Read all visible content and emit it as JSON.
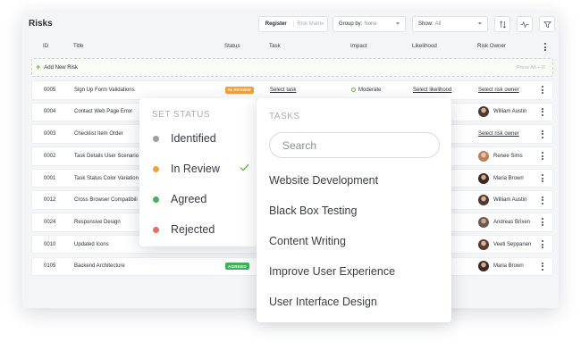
{
  "page": {
    "title": "Risks"
  },
  "toolbar": {
    "view_register": "Register",
    "view_matrix": "Risk Matrix",
    "group_label": "Group by:",
    "group_value": "None",
    "show_label": "Show:",
    "show_value": "All"
  },
  "columns": [
    "ID",
    "Title",
    "Status",
    "Task",
    "Impact",
    "Likelihood",
    "Risk Owner"
  ],
  "add_row": {
    "label": "Add New Risk",
    "hint": "Press Alt + R"
  },
  "rows": [
    {
      "id": "0005",
      "title": "Sign Up Form Validations",
      "status": "IN REVIEW",
      "status_color": "#f0a23e",
      "task": "Select task",
      "impact": "Moderate",
      "likelihood": "Select likelihood",
      "owner": "Select risk owner"
    },
    {
      "id": "0004",
      "title": "Contact Web Page Error",
      "owner": "William Austin"
    },
    {
      "id": "0003",
      "title": "Checklist Item Order",
      "owner": "Select risk owner"
    },
    {
      "id": "0002",
      "title": "Task Details User Scenario",
      "owner": "Renee Sims"
    },
    {
      "id": "0001",
      "title": "Task Status Color Variation",
      "owner": "Maria Brown"
    },
    {
      "id": "0012",
      "title": "Cross Browser Compatibili",
      "owner": "William Austin"
    },
    {
      "id": "0024",
      "title": "Responsive Design",
      "owner": "Andreas Brixen"
    },
    {
      "id": "0010",
      "title": "Updated Icons",
      "owner": "Veeti Seppanen"
    },
    {
      "id": "0105",
      "title": "Backend Architecture",
      "status": "AGREED",
      "status_color": "#3fb25a",
      "owner": "Maria Brown"
    }
  ],
  "status_popover": {
    "heading": "SET STATUS",
    "options": [
      {
        "label": "Identified",
        "color": "#9c9fa6"
      },
      {
        "label": "In Review",
        "color": "#f0a23e",
        "selected": true
      },
      {
        "label": "Agreed",
        "color": "#3fb25a"
      },
      {
        "label": "Rejected",
        "color": "#ec6b5e"
      }
    ],
    "check_color": "#6cbe45"
  },
  "tasks_popover": {
    "heading": "TASKS",
    "search_placeholder": "Search",
    "items": [
      "Website Development",
      "Black Box Testing",
      "Content Writing",
      "Improve User Experience",
      "User Interface Design"
    ]
  },
  "icons": [
    "sort-icon",
    "activity-icon",
    "filter-icon",
    "plus-icon",
    "kebab-menu-icon",
    "check-icon"
  ]
}
